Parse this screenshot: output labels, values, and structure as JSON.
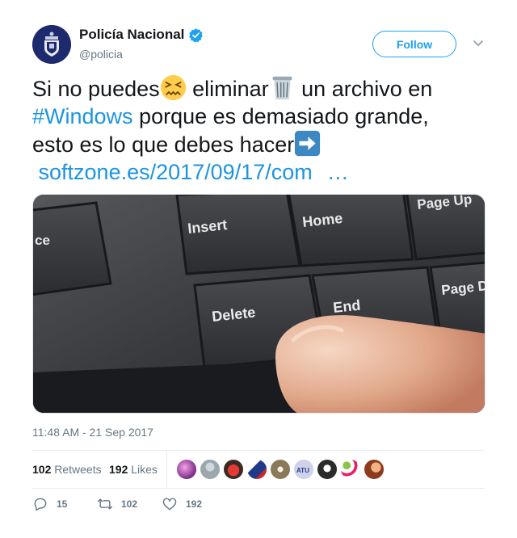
{
  "author": {
    "name": "Policía Nacional",
    "handle": "@policia",
    "verified": true
  },
  "follow_label": "Follow",
  "tweet": {
    "line1_a": "Si no puedes",
    "line1_b": " eliminar",
    "line1_c": " un archivo en",
    "hashtag": "#Windows",
    "line2_rest": " porque es demasiado grande,",
    "line3": "esto es lo que debes hacer",
    "link": "softzone.es/2017/09/17/com",
    "ellipsis": "…",
    "emojis": [
      "confounded-face-emoji",
      "wastebasket-emoji",
      "right-arrow-emoji"
    ]
  },
  "media": {
    "keys": [
      "Insert",
      "Home",
      "Page Up",
      "Delete",
      "End",
      "Page Down"
    ]
  },
  "timestamp": "11:48 AM - 21 Sep 2017",
  "stats": {
    "retweets_count": "102",
    "retweets_label": "Retweets",
    "likes_count": "192",
    "likes_label": "Likes"
  },
  "actions": {
    "reply_count": "15",
    "retweet_count": "102",
    "like_count": "192"
  },
  "colors": {
    "accent": "#1da1f2",
    "link": "#1b95e0",
    "muted": "#657786"
  }
}
